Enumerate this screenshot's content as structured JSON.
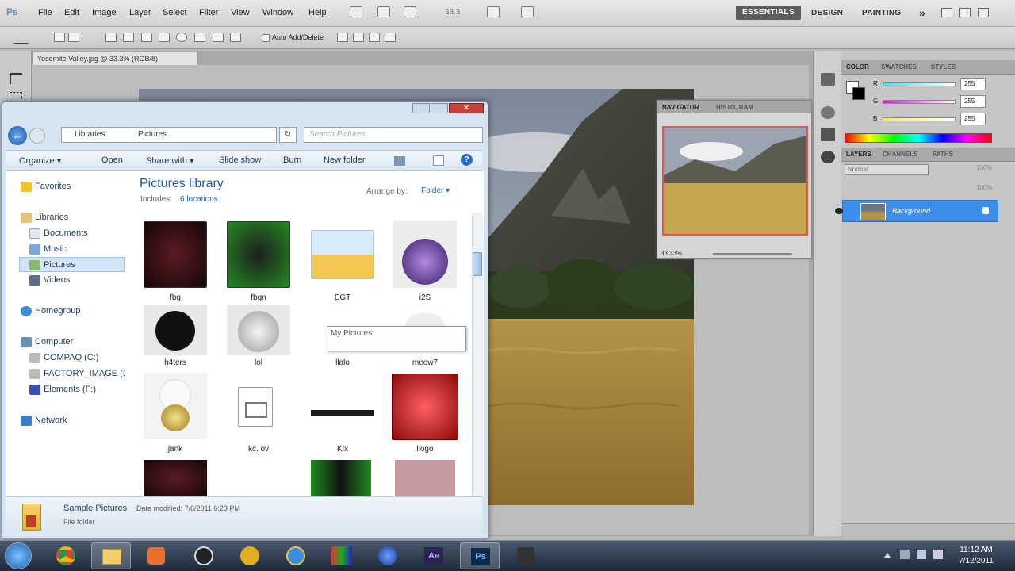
{
  "ps": {
    "logo": "Ps",
    "menu": [
      "File",
      "Edit",
      "Image",
      "Layer",
      "Select",
      "Filter",
      "View",
      "Window",
      "Help"
    ],
    "zoom_field": "33.3",
    "workspaces": {
      "essentials": "ESSENTIALS",
      "design": "DESIGN",
      "painting": "PAINTING",
      "more": "»"
    },
    "options_bar": {
      "auto_add_delete": "Auto Add/Delete"
    },
    "document_tab": "Yosemite Valley.jpg @ 33.3% (RGB/8)",
    "color_panel": {
      "tabs": [
        "COLOR",
        "SWATCHES",
        "STYLES"
      ],
      "channels": [
        {
          "label": "R",
          "value": "255"
        },
        {
          "label": "G",
          "value": "255"
        },
        {
          "label": "B",
          "value": "255"
        }
      ]
    },
    "navigator": {
      "tabs": [
        "NAVIGATOR",
        "HISTO..RAM"
      ],
      "zoom": "33.33%"
    },
    "layers_panel": {
      "tabs": [
        "LAYERS",
        "CHANNELS",
        "PATHS"
      ],
      "blend_mode": "Normal",
      "opacity": "100%",
      "fill": "100%",
      "layer_name": "Background"
    }
  },
  "explorer": {
    "breadcrumb": [
      "Libraries",
      "Pictures"
    ],
    "search_placeholder": "Search Pictures",
    "commands": [
      "Organize ▾",
      "Open",
      "Share with ▾",
      "Slide show",
      "Burn",
      "New folder"
    ],
    "nav": {
      "favorites": "Favorites",
      "libraries": "Libraries",
      "documents": "Documents",
      "music": "Music",
      "pictures": "Pictures",
      "videos": "Videos",
      "homegroup": "Homegroup",
      "computer": "Computer",
      "drives": [
        "COMPAQ (C:)",
        "FACTORY_IMAGE (D",
        "Elements (F:)"
      ],
      "network": "Network"
    },
    "library_title": "Pictures library",
    "includes_label": "Includes:",
    "includes_link": "6 locations",
    "arrange_label": "Arrange by:",
    "arrange_value": "Folder ▾",
    "thumbs": [
      {
        "caption": "fbg",
        "color": "#3a1418"
      },
      {
        "caption": "fbgn",
        "color": "#1f6b1f"
      },
      {
        "caption": "EGT",
        "color": "#cfe1f0"
      },
      {
        "caption": "i2S",
        "color": "#4a2c78"
      },
      {
        "caption": "h4ters",
        "color": "#e8e8e8"
      },
      {
        "caption": "lol",
        "color": "#e8e8e8"
      },
      {
        "caption": "llalo",
        "color": "#ffffff"
      },
      {
        "caption": "meow7",
        "color": "#ffffff"
      },
      {
        "caption": "jank",
        "color": "#f3f3f3"
      },
      {
        "caption": "kc. ov",
        "color": "#ffffff"
      },
      {
        "caption": "Klx",
        "color": "#ffffff"
      },
      {
        "caption": "llogo",
        "color": "#c01818"
      }
    ],
    "tooltip": {
      "title": "My Pictures"
    },
    "status": {
      "name": "Sample Pictures",
      "date_label": "Date modified: 7/6/2011 6:23 PM",
      "type": "File folder"
    }
  },
  "taskbar": {
    "time": "11:12 AM",
    "date": "7/12/2011"
  }
}
